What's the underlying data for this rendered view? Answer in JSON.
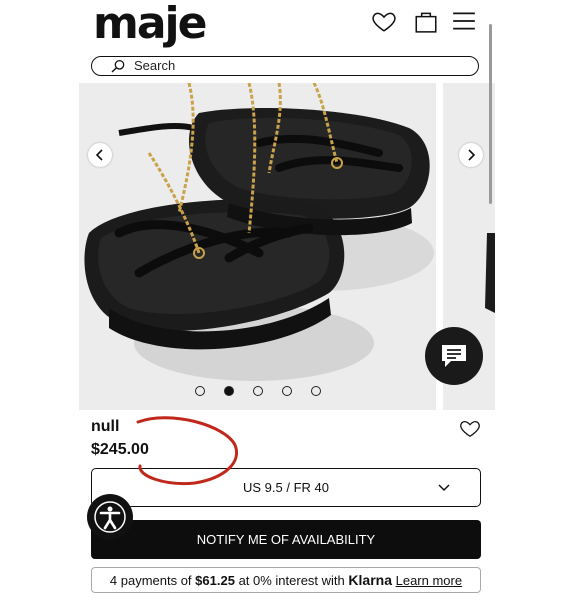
{
  "header": {
    "logo": "maje",
    "wishlist_icon": "heart-icon",
    "bag_icon": "bag-icon",
    "menu_icon": "hamburger-menu-icon"
  },
  "search": {
    "placeholder": "Search",
    "icon": "search-icon"
  },
  "gallery": {
    "prev_icon": "chevron-left-icon",
    "next_icon": "chevron-right-icon",
    "slide_count": 5,
    "active_index": 1
  },
  "chat": {
    "icon": "chat-bubble-icon"
  },
  "product": {
    "name": "null",
    "price": "$245.00",
    "wishlist_icon": "heart-icon"
  },
  "size_select": {
    "value": "US 9.5 / FR 40",
    "icon": "chevron-down-icon"
  },
  "notify_button": {
    "label": "NOTIFY ME OF AVAILABILITY"
  },
  "klarna": {
    "prefix": "4 payments of",
    "amount": "$61.25",
    "middle": "at 0% interest with",
    "brand": "Klarna",
    "link": "Learn more"
  },
  "accessibility": {
    "icon": "accessibility-icon"
  },
  "colors": {
    "primary": "#111111",
    "annotation": "#c0281c",
    "hero_bg": "#ececec"
  }
}
